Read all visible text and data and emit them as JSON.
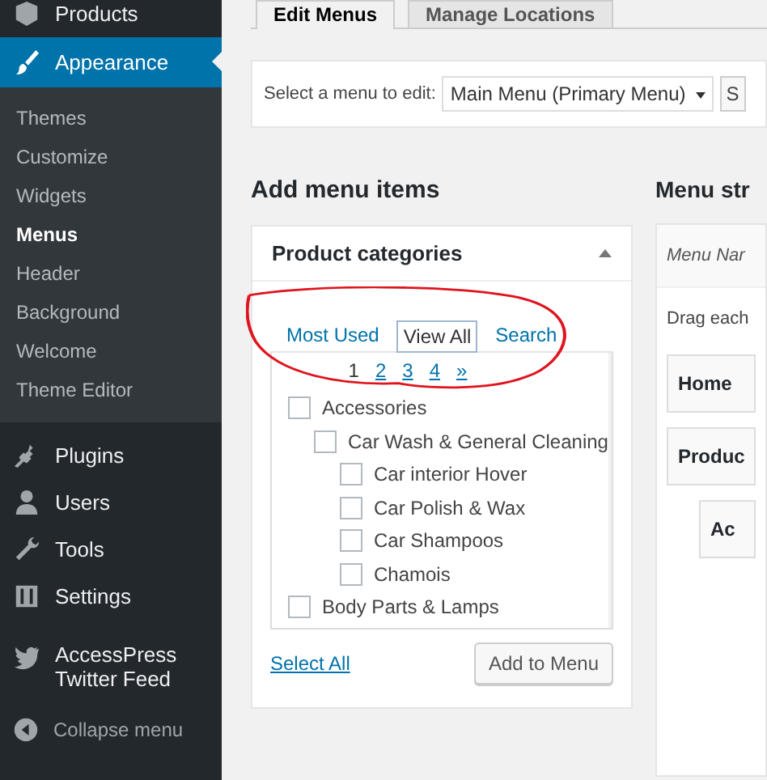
{
  "sidebar": {
    "items": [
      {
        "label": "Products",
        "current": false
      },
      {
        "label": "Appearance",
        "current": true,
        "submenu": [
          {
            "label": "Themes",
            "selected": false
          },
          {
            "label": "Customize",
            "selected": false
          },
          {
            "label": "Widgets",
            "selected": false
          },
          {
            "label": "Menus",
            "selected": true
          },
          {
            "label": "Header",
            "selected": false
          },
          {
            "label": "Background",
            "selected": false
          },
          {
            "label": "Welcome",
            "selected": false
          },
          {
            "label": "Theme Editor",
            "selected": false
          }
        ]
      },
      {
        "label": "Plugins",
        "current": false
      },
      {
        "label": "Users",
        "current": false
      },
      {
        "label": "Tools",
        "current": false
      },
      {
        "label": "Settings",
        "current": false
      },
      {
        "label": "AccessPress Twitter Feed",
        "current": false
      }
    ],
    "collapse": "Collapse menu"
  },
  "tabs": [
    {
      "label": "Edit Menus",
      "selected": true
    },
    {
      "label": "Manage Locations",
      "selected": false
    }
  ],
  "menu_select": {
    "label": "Select a menu to edit:",
    "value": "Main Menu (Primary Menu)",
    "button": "S"
  },
  "add_items": {
    "title": "Add menu items",
    "panel": {
      "title": "Product categories",
      "tabs": [
        {
          "label": "Most Used",
          "selected": false
        },
        {
          "label": "View All",
          "selected": true
        },
        {
          "label": "Search",
          "selected": false
        }
      ],
      "pages": [
        {
          "label": "1",
          "selected": true
        },
        {
          "label": "2",
          "selected": false
        },
        {
          "label": "3",
          "selected": false
        },
        {
          "label": "4",
          "selected": false
        },
        {
          "label": "»",
          "selected": false
        }
      ],
      "categories": [
        {
          "label": "Accessories",
          "checked": false,
          "children": [
            {
              "label": "Car Wash & General Cleaning",
              "checked": false,
              "children": [
                {
                  "label": "Car interior Hover",
                  "checked": false
                },
                {
                  "label": "Car Polish & Wax",
                  "checked": false
                },
                {
                  "label": "Car Shampoos",
                  "checked": false
                },
                {
                  "label": "Chamois",
                  "checked": false
                }
              ]
            }
          ]
        },
        {
          "label": "Body Parts & Lamps",
          "checked": false
        }
      ],
      "select_all": "Select All",
      "add_button": "Add to Menu"
    }
  },
  "menu_structure": {
    "title": "Menu str",
    "name_label": "Menu Nar",
    "hint": "Drag each",
    "items": [
      "Home",
      "Produc",
      "Ac"
    ]
  }
}
